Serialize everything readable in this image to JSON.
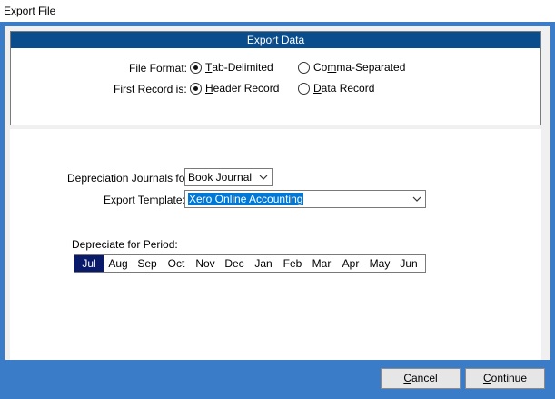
{
  "window": {
    "title": "Export File"
  },
  "panel": {
    "header": "Export Data"
  },
  "file_format": {
    "label": "File Format:",
    "options": [
      {
        "accel": "T",
        "rest": "ab-Delimited",
        "checked": true
      },
      {
        "pre": "Co",
        "accel": "m",
        "rest": "ma-Separated",
        "checked": false
      }
    ]
  },
  "first_record": {
    "label": "First Record is:",
    "options": [
      {
        "accel": "H",
        "rest": "eader Record",
        "checked": true
      },
      {
        "accel": "D",
        "rest": "ata Record",
        "checked": false
      }
    ]
  },
  "depreciation_journals": {
    "label": "Depreciation Journals for:",
    "value": "Book Journal"
  },
  "export_template": {
    "label": "Export Template:",
    "value": "Xero Online Accounting"
  },
  "period": {
    "label": "Depreciate  for Period:",
    "months": [
      "Jul",
      "Aug",
      "Sep",
      "Oct",
      "Nov",
      "Dec",
      "Jan",
      "Feb",
      "Mar",
      "Apr",
      "May",
      "Jun"
    ],
    "selected": "Jul"
  },
  "buttons": {
    "cancel": {
      "accel": "C",
      "rest": "ancel"
    },
    "continue": {
      "accel": "C",
      "rest": "ontinue"
    }
  },
  "colors": {
    "frame": "#3a7cc7",
    "panel_header": "#0a4d8c",
    "selected_month": "#0a1a6b",
    "selection": "#0078d7"
  }
}
